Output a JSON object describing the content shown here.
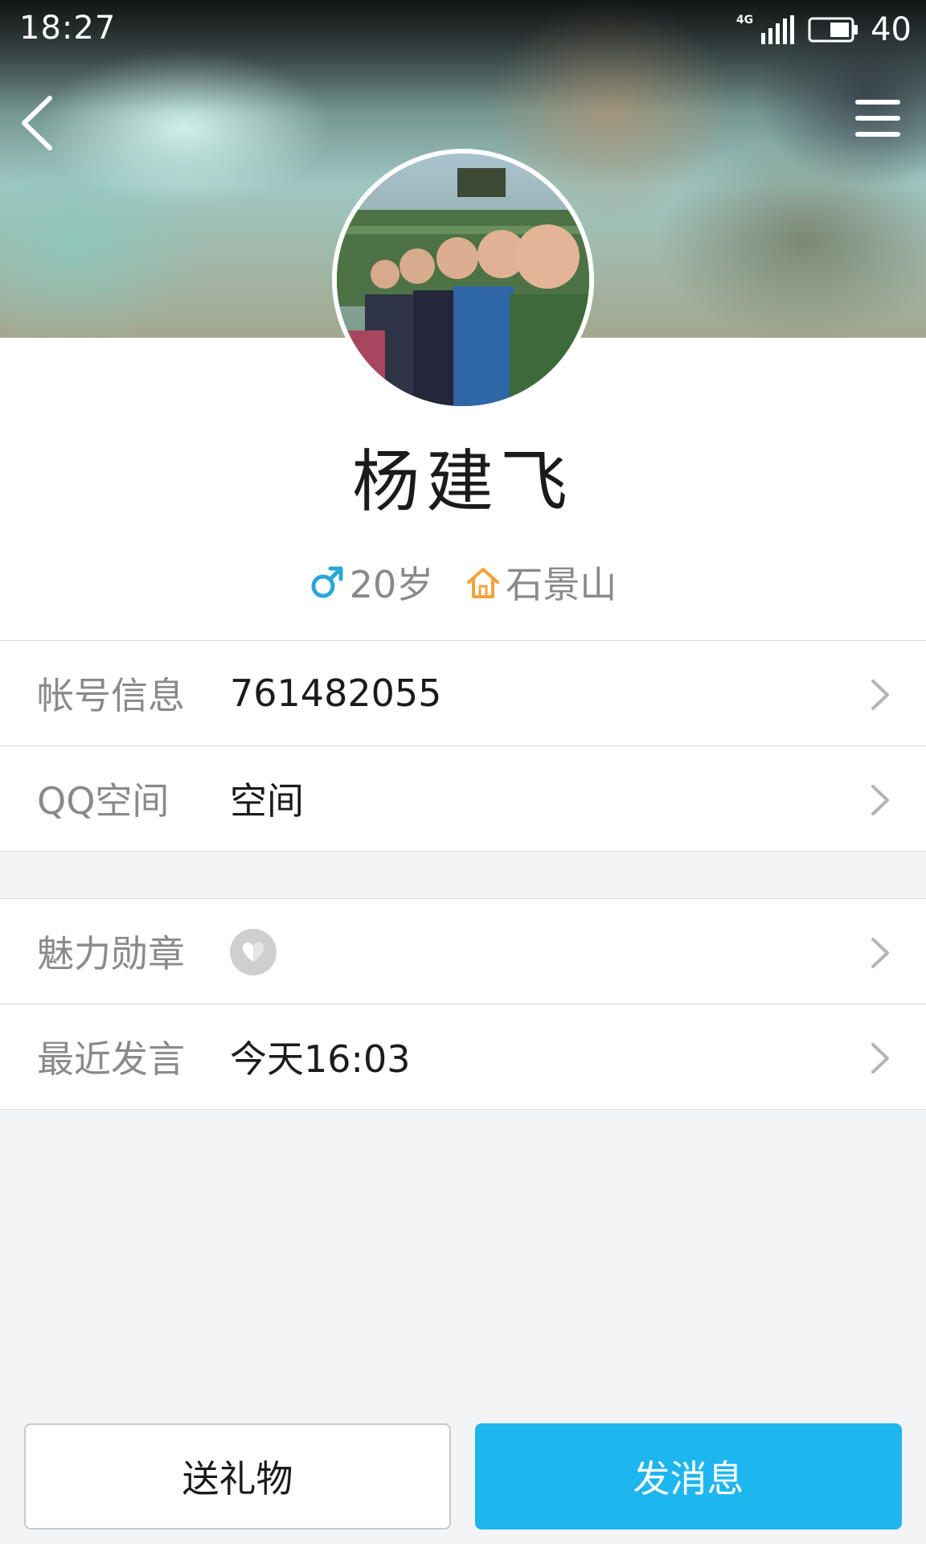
{
  "status_bar": {
    "time": "18:27",
    "network": "4G",
    "battery": "40"
  },
  "nav": {
    "back_icon": "chevron-left-icon",
    "menu_icon": "hamburger-menu-icon"
  },
  "profile": {
    "name": "杨建飞",
    "gender_icon": "male-symbol-icon",
    "age": "20岁",
    "home_icon": "home-icon",
    "location": "石景山",
    "colors": {
      "gender": "#29a7d6",
      "home": "#f5a13a",
      "accent": "#1eb6ee"
    }
  },
  "rows": {
    "account": {
      "label": "帐号信息",
      "value": "761482055"
    },
    "qzone": {
      "label": "QQ空间",
      "value": "空间"
    },
    "badge": {
      "label": "魅力勋章",
      "icon": "heart-badge-icon"
    },
    "recent": {
      "label": "最近发言",
      "value": "今天16:03"
    }
  },
  "actions": {
    "gift_label": "送礼物",
    "message_label": "发消息"
  }
}
